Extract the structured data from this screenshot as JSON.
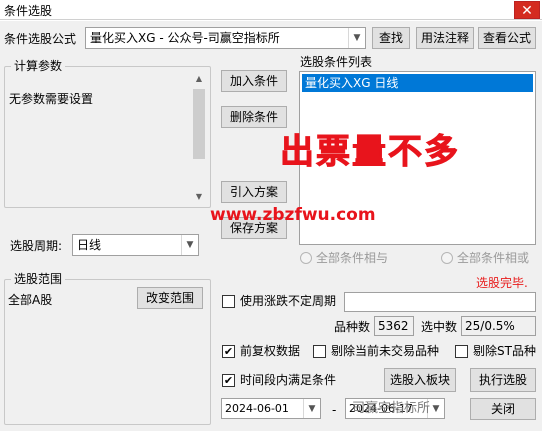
{
  "window": {
    "title": "条件选股",
    "close_glyph": "✕"
  },
  "formula": {
    "label": "条件选股公式",
    "value": "量化买入XG  -  公众号-司赢空指标所",
    "buttons": {
      "find": "查找",
      "usage": "用法注释",
      "view": "查看公式"
    }
  },
  "params": {
    "legend": "计算参数",
    "text": "无参数需要设置"
  },
  "period": {
    "label": "选股周期:",
    "value": "日线"
  },
  "actions": {
    "add": "加入条件",
    "delete": "删除条件",
    "import": "引入方案",
    "save": "保存方案"
  },
  "condition_list": {
    "title": "选股条件列表",
    "items": [
      "量化买入XG  日线"
    ]
  },
  "logic": {
    "and": "全部条件相与",
    "or": "全部条件相或"
  },
  "status": {
    "text": "选股完毕."
  },
  "range": {
    "legend": "选股范围",
    "value": "全部A股",
    "change_button": "改变范围"
  },
  "limit_period": {
    "label": "使用涨跌不定周期"
  },
  "counts": {
    "varieties_label": "品种数",
    "varieties_value": "5362",
    "selected_label": "选中数",
    "selected_value": "25/0.5%"
  },
  "options": {
    "fq": "前复权数据",
    "exclude_untraded": "剔除当前未交易品种",
    "exclude_st": "剔除ST品种"
  },
  "time": {
    "label": "时间段内满足条件",
    "from": "2024-06-01",
    "sep": "-",
    "to": "2024-06-17"
  },
  "bottom_buttons": {
    "to_block": "选股入板块",
    "run": "执行选股",
    "close": "关闭"
  },
  "overlay": {
    "headline": "出票量不多",
    "url": "www.zbzfwu.com",
    "watermark": "司赢空指标所"
  },
  "colors": {
    "selection": "#0078d7",
    "overlay_red": "#e8141c",
    "close_red": "#d42b20"
  }
}
